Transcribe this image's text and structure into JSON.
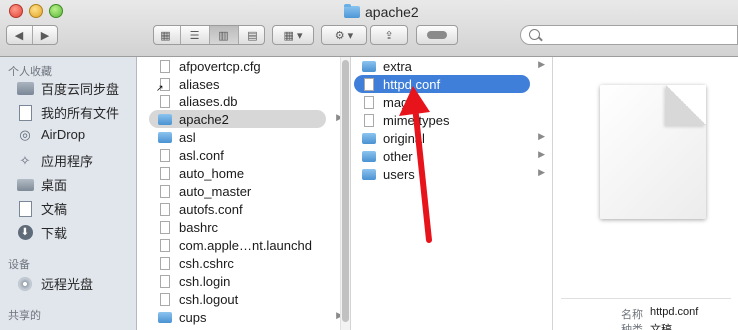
{
  "window": {
    "title": "apache2"
  },
  "toolbar": {
    "back_icon": "chevron-left-icon",
    "forward_icon": "chevron-right-icon",
    "view_modes": [
      "icon-view",
      "list-view",
      "column-view",
      "cover-flow-view"
    ],
    "active_view": "column-view",
    "arrange_icon": "grid-icon",
    "action_icon": "gear-icon",
    "share_icon": "share-icon",
    "tag_icon": "toggle-icon",
    "search_placeholder": ""
  },
  "sidebar": {
    "favorites_label": "个人收藏",
    "devices_label": "设备",
    "shared_label": "共享的",
    "items": [
      {
        "label": "百度云同步盘",
        "icon": "folder-icon"
      },
      {
        "label": "我的所有文件",
        "icon": "all-files-icon"
      },
      {
        "label": "AirDrop",
        "icon": "airdrop-icon"
      },
      {
        "label": "应用程序",
        "icon": "applications-icon"
      },
      {
        "label": "桌面",
        "icon": "desktop-icon"
      },
      {
        "label": "文稿",
        "icon": "documents-icon"
      },
      {
        "label": "下载",
        "icon": "downloads-icon"
      }
    ],
    "devices": [
      {
        "label": "远程光盘",
        "icon": "disc-icon"
      }
    ]
  },
  "column1": {
    "items": [
      {
        "label": "afpovertcp.cfg",
        "kind": "file"
      },
      {
        "label": "aliases",
        "kind": "alias"
      },
      {
        "label": "aliases.db",
        "kind": "file"
      },
      {
        "label": "apache2",
        "kind": "folder",
        "selected": true
      },
      {
        "label": "asl",
        "kind": "folder"
      },
      {
        "label": "asl.conf",
        "kind": "file"
      },
      {
        "label": "auto_home",
        "kind": "file"
      },
      {
        "label": "auto_master",
        "kind": "file"
      },
      {
        "label": "autofs.conf",
        "kind": "file"
      },
      {
        "label": "bashrc",
        "kind": "file"
      },
      {
        "label": "com.apple…nt.launchd",
        "kind": "file"
      },
      {
        "label": "csh.cshrc",
        "kind": "file"
      },
      {
        "label": "csh.login",
        "kind": "file"
      },
      {
        "label": "csh.logout",
        "kind": "file"
      },
      {
        "label": "cups",
        "kind": "folder"
      }
    ]
  },
  "column2": {
    "items": [
      {
        "label": "extra",
        "kind": "folder"
      },
      {
        "label": "httpd.conf",
        "kind": "file",
        "selected": true
      },
      {
        "label": "magic",
        "kind": "file"
      },
      {
        "label": "mime.types",
        "kind": "file"
      },
      {
        "label": "original",
        "kind": "folder"
      },
      {
        "label": "other",
        "kind": "folder"
      },
      {
        "label": "users",
        "kind": "folder"
      }
    ]
  },
  "preview": {
    "name_label": "名称",
    "name_value": "httpd.conf",
    "kind_label": "种类",
    "kind_value": "文稿"
  },
  "colors": {
    "selection_blue": "#3f7fd9",
    "annotation_arrow": "#e8141c",
    "sidebar_bg": "#e1e6ed"
  }
}
